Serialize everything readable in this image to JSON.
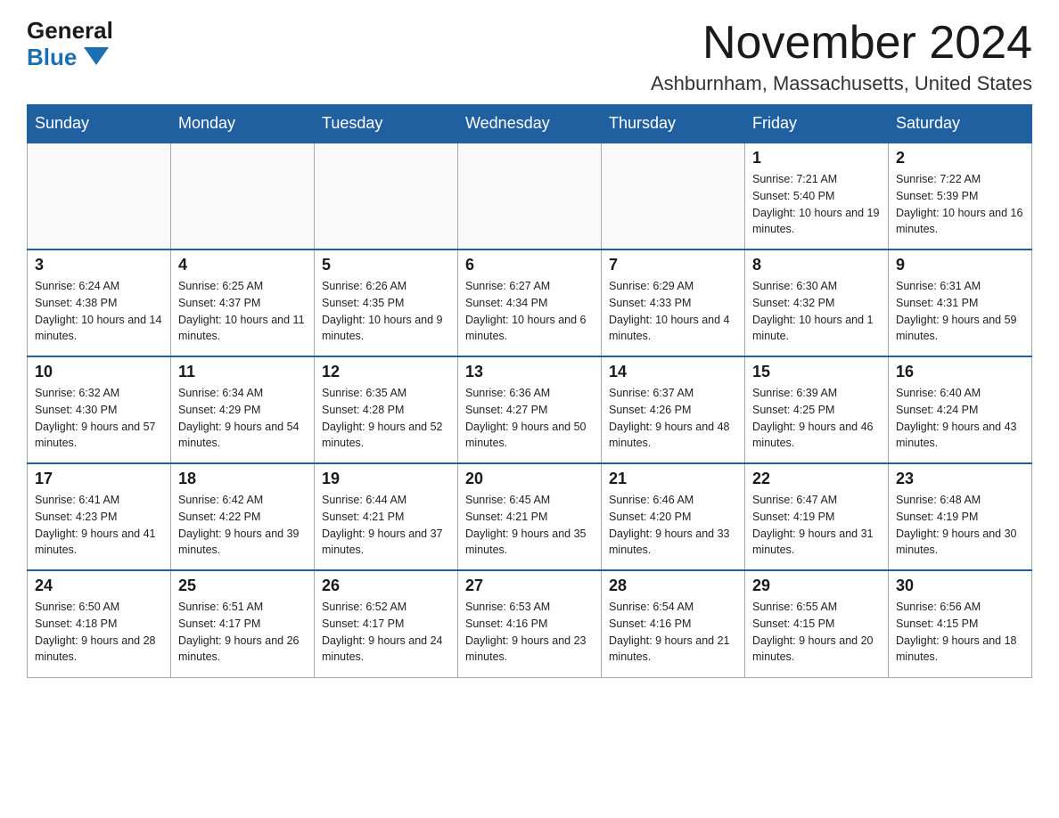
{
  "logo": {
    "general": "General",
    "blue": "Blue"
  },
  "title": {
    "month": "November 2024",
    "location": "Ashburnham, Massachusetts, United States"
  },
  "days_of_week": [
    "Sunday",
    "Monday",
    "Tuesday",
    "Wednesday",
    "Thursday",
    "Friday",
    "Saturday"
  ],
  "weeks": [
    [
      {
        "day": "",
        "info": ""
      },
      {
        "day": "",
        "info": ""
      },
      {
        "day": "",
        "info": ""
      },
      {
        "day": "",
        "info": ""
      },
      {
        "day": "",
        "info": ""
      },
      {
        "day": "1",
        "info": "Sunrise: 7:21 AM\nSunset: 5:40 PM\nDaylight: 10 hours and 19 minutes."
      },
      {
        "day": "2",
        "info": "Sunrise: 7:22 AM\nSunset: 5:39 PM\nDaylight: 10 hours and 16 minutes."
      }
    ],
    [
      {
        "day": "3",
        "info": "Sunrise: 6:24 AM\nSunset: 4:38 PM\nDaylight: 10 hours and 14 minutes."
      },
      {
        "day": "4",
        "info": "Sunrise: 6:25 AM\nSunset: 4:37 PM\nDaylight: 10 hours and 11 minutes."
      },
      {
        "day": "5",
        "info": "Sunrise: 6:26 AM\nSunset: 4:35 PM\nDaylight: 10 hours and 9 minutes."
      },
      {
        "day": "6",
        "info": "Sunrise: 6:27 AM\nSunset: 4:34 PM\nDaylight: 10 hours and 6 minutes."
      },
      {
        "day": "7",
        "info": "Sunrise: 6:29 AM\nSunset: 4:33 PM\nDaylight: 10 hours and 4 minutes."
      },
      {
        "day": "8",
        "info": "Sunrise: 6:30 AM\nSunset: 4:32 PM\nDaylight: 10 hours and 1 minute."
      },
      {
        "day": "9",
        "info": "Sunrise: 6:31 AM\nSunset: 4:31 PM\nDaylight: 9 hours and 59 minutes."
      }
    ],
    [
      {
        "day": "10",
        "info": "Sunrise: 6:32 AM\nSunset: 4:30 PM\nDaylight: 9 hours and 57 minutes."
      },
      {
        "day": "11",
        "info": "Sunrise: 6:34 AM\nSunset: 4:29 PM\nDaylight: 9 hours and 54 minutes."
      },
      {
        "day": "12",
        "info": "Sunrise: 6:35 AM\nSunset: 4:28 PM\nDaylight: 9 hours and 52 minutes."
      },
      {
        "day": "13",
        "info": "Sunrise: 6:36 AM\nSunset: 4:27 PM\nDaylight: 9 hours and 50 minutes."
      },
      {
        "day": "14",
        "info": "Sunrise: 6:37 AM\nSunset: 4:26 PM\nDaylight: 9 hours and 48 minutes."
      },
      {
        "day": "15",
        "info": "Sunrise: 6:39 AM\nSunset: 4:25 PM\nDaylight: 9 hours and 46 minutes."
      },
      {
        "day": "16",
        "info": "Sunrise: 6:40 AM\nSunset: 4:24 PM\nDaylight: 9 hours and 43 minutes."
      }
    ],
    [
      {
        "day": "17",
        "info": "Sunrise: 6:41 AM\nSunset: 4:23 PM\nDaylight: 9 hours and 41 minutes."
      },
      {
        "day": "18",
        "info": "Sunrise: 6:42 AM\nSunset: 4:22 PM\nDaylight: 9 hours and 39 minutes."
      },
      {
        "day": "19",
        "info": "Sunrise: 6:44 AM\nSunset: 4:21 PM\nDaylight: 9 hours and 37 minutes."
      },
      {
        "day": "20",
        "info": "Sunrise: 6:45 AM\nSunset: 4:21 PM\nDaylight: 9 hours and 35 minutes."
      },
      {
        "day": "21",
        "info": "Sunrise: 6:46 AM\nSunset: 4:20 PM\nDaylight: 9 hours and 33 minutes."
      },
      {
        "day": "22",
        "info": "Sunrise: 6:47 AM\nSunset: 4:19 PM\nDaylight: 9 hours and 31 minutes."
      },
      {
        "day": "23",
        "info": "Sunrise: 6:48 AM\nSunset: 4:19 PM\nDaylight: 9 hours and 30 minutes."
      }
    ],
    [
      {
        "day": "24",
        "info": "Sunrise: 6:50 AM\nSunset: 4:18 PM\nDaylight: 9 hours and 28 minutes."
      },
      {
        "day": "25",
        "info": "Sunrise: 6:51 AM\nSunset: 4:17 PM\nDaylight: 9 hours and 26 minutes."
      },
      {
        "day": "26",
        "info": "Sunrise: 6:52 AM\nSunset: 4:17 PM\nDaylight: 9 hours and 24 minutes."
      },
      {
        "day": "27",
        "info": "Sunrise: 6:53 AM\nSunset: 4:16 PM\nDaylight: 9 hours and 23 minutes."
      },
      {
        "day": "28",
        "info": "Sunrise: 6:54 AM\nSunset: 4:16 PM\nDaylight: 9 hours and 21 minutes."
      },
      {
        "day": "29",
        "info": "Sunrise: 6:55 AM\nSunset: 4:15 PM\nDaylight: 9 hours and 20 minutes."
      },
      {
        "day": "30",
        "info": "Sunrise: 6:56 AM\nSunset: 4:15 PM\nDaylight: 9 hours and 18 minutes."
      }
    ]
  ]
}
